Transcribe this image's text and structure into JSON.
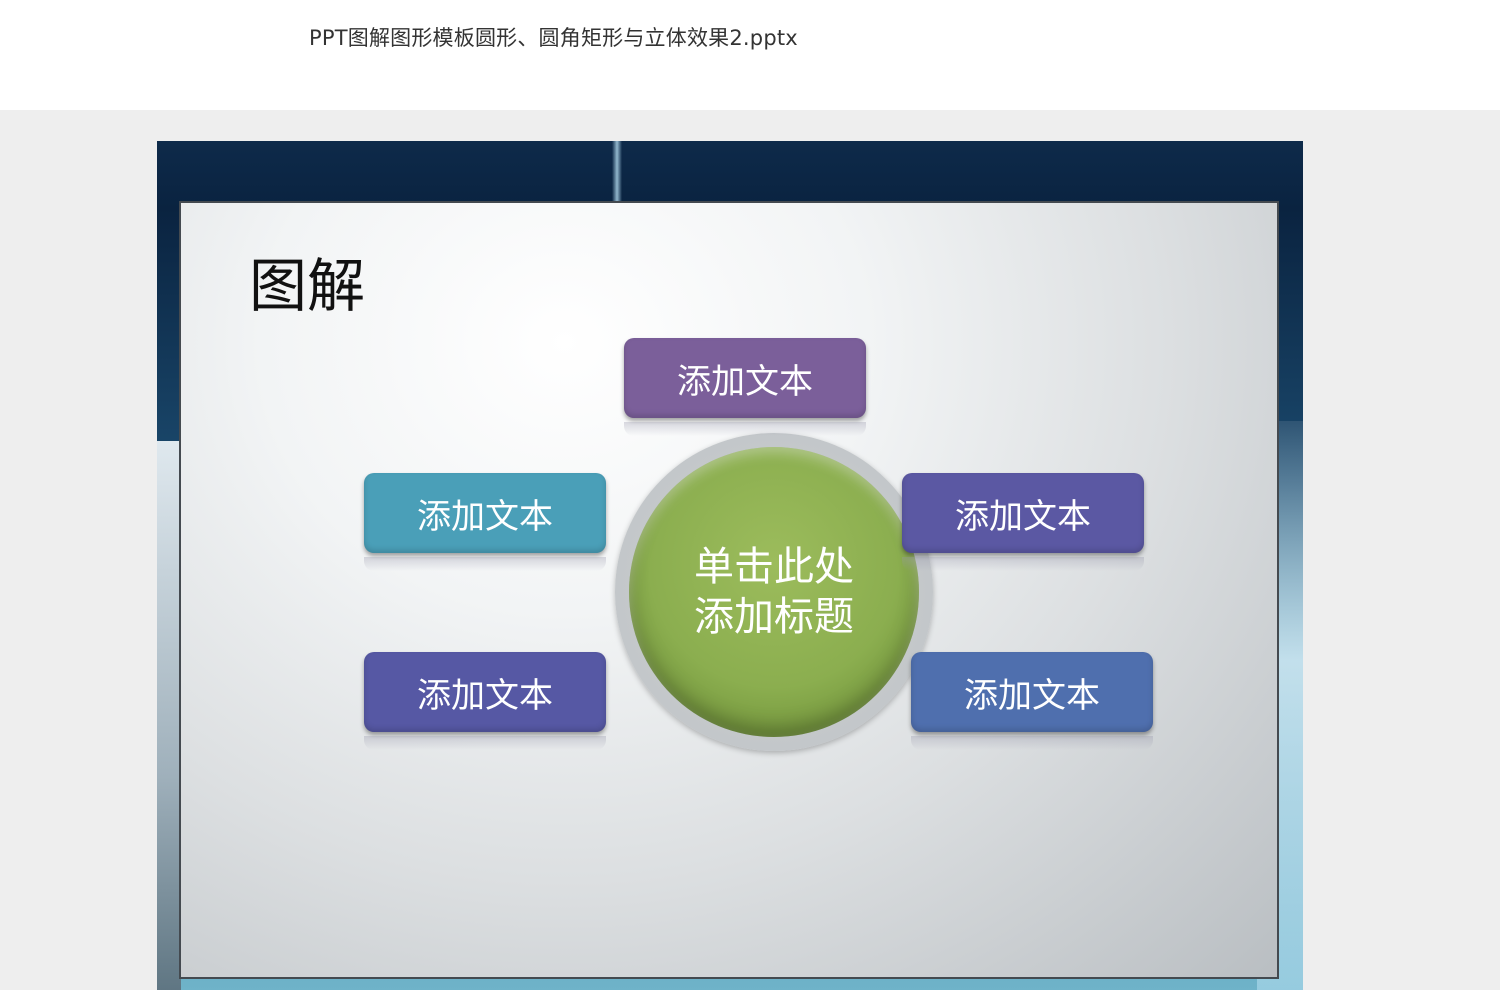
{
  "file": {
    "title": "PPT图解图形模板圆形、圆角矩形与立体效果2.pptx"
  },
  "slide": {
    "title": "图解",
    "center": {
      "line1": "单击此处",
      "line2": "添加标题",
      "color": "#8bae4f"
    },
    "boxes": [
      {
        "id": "top",
        "label": "添加文本",
        "color": "#7b5f9a"
      },
      {
        "id": "left-upper",
        "label": "添加文本",
        "color": "#4a9fb8"
      },
      {
        "id": "right-upper",
        "label": "添加文本",
        "color": "#5b58a3"
      },
      {
        "id": "left-lower",
        "label": "添加文本",
        "color": "#5658a4"
      },
      {
        "id": "right-lower",
        "label": "添加文本",
        "color": "#4f6fae"
      }
    ]
  }
}
